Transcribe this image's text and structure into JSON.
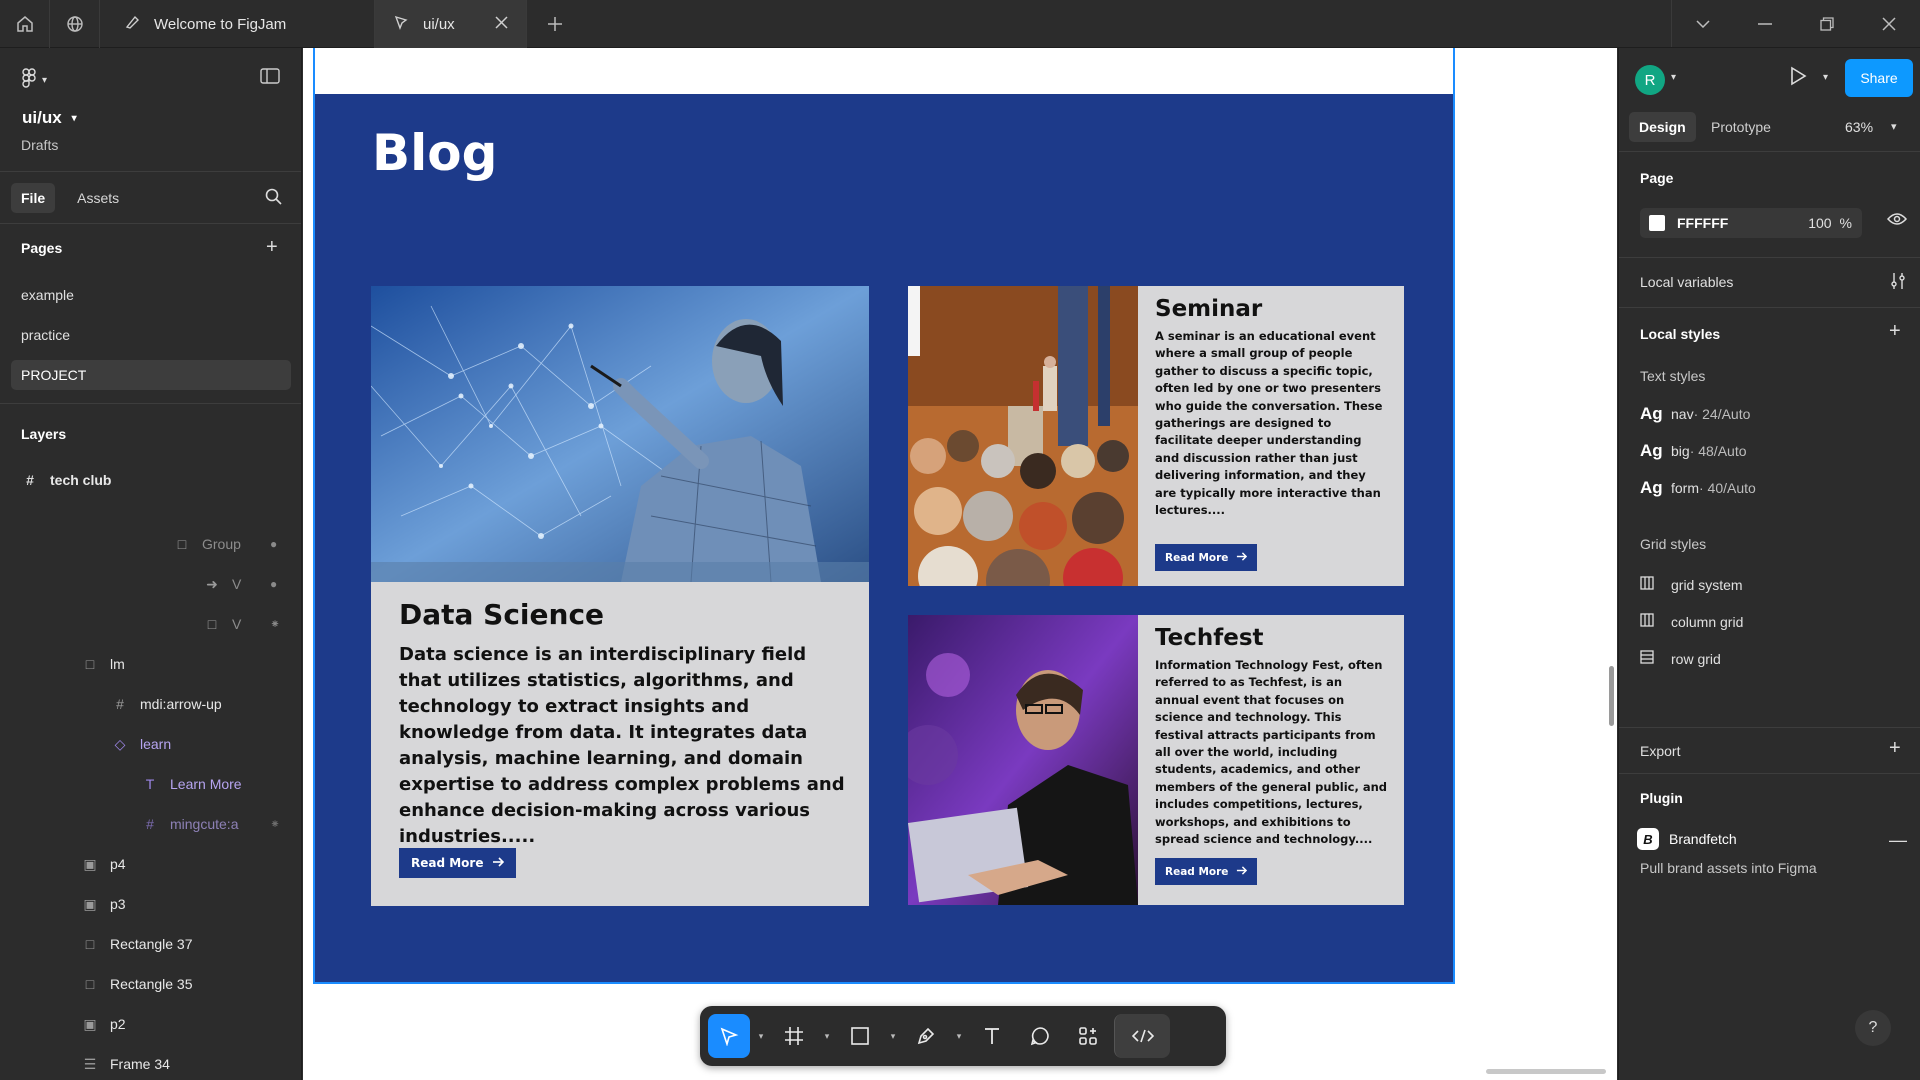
{
  "tabs": [
    {
      "label": "Welcome to FigJam"
    },
    {
      "label": "ui/ux"
    }
  ],
  "left": {
    "file_name": "ui/ux",
    "location": "Drafts",
    "tab_file": "File",
    "tab_assets": "Assets",
    "pages_title": "Pages",
    "pages": [
      "example",
      "practice",
      "PROJECT"
    ],
    "layers_title": "Layers",
    "layers": [
      {
        "name": "tech club",
        "icon": "frame-icon"
      },
      {
        "name": "Group",
        "icon": "group-icon"
      },
      {
        "name": "V",
        "icon": "arrow-icon"
      },
      {
        "name": "V",
        "icon": "rectangle-icon"
      },
      {
        "name": "lm",
        "icon": "group-icon"
      },
      {
        "name": "mdi:arrow-up",
        "icon": "frame-icon"
      },
      {
        "name": "learn",
        "icon": "component-icon"
      },
      {
        "name": "Learn More",
        "icon": "text-icon"
      },
      {
        "name": "mingcute:a",
        "icon": "frame-icon"
      },
      {
        "name": "p4",
        "icon": "image-icon"
      },
      {
        "name": "p3",
        "icon": "image-icon"
      },
      {
        "name": "Rectangle 37",
        "icon": "rectangle-icon"
      },
      {
        "name": "Rectangle 35",
        "icon": "rectangle-icon"
      },
      {
        "name": "p2",
        "icon": "image-icon"
      },
      {
        "name": "Frame 34",
        "icon": "auto-layout-icon"
      }
    ]
  },
  "canvas": {
    "blog_title": "Blog",
    "cards": [
      {
        "title": "Data Science",
        "body": "Data science is an interdisciplinary field that utilizes statistics, algorithms, and technology to extract insights and knowledge from data. It integrates data analysis, machine learning, and domain expertise to address complex problems and enhance decision-making across various industries.....",
        "button": "Read More"
      },
      {
        "title": "Seminar",
        "body": "A seminar is an educational event where a small group of people gather to discuss a specific topic, often led by one or two presenters who guide the conversation. These gatherings are designed to facilitate deeper understanding and discussion rather than just delivering information, and they are typically more interactive than lectures....",
        "button": "Read More"
      },
      {
        "title": "Techfest",
        "body": "Information Technology Fest, often referred to as Techfest, is an annual event that focuses on science and technology. This festival attracts participants from all over the world, including students, academics, and other members of the general public, and includes competitions, lectures, workshops, and exhibitions to spread science and technology....",
        "button": "Read More"
      }
    ]
  },
  "right": {
    "avatar_initial": "R",
    "share": "Share",
    "tab_design": "Design",
    "tab_prototype": "Prototype",
    "zoom": "63%",
    "page_title": "Page",
    "page_color": "FFFFFF",
    "page_opacity": "100",
    "page_opacity_unit": "%",
    "local_variables": "Local variables",
    "local_styles": "Local styles",
    "text_styles_title": "Text styles",
    "text_styles": [
      {
        "ag": "Ag",
        "name": "nav",
        "meta": " · 24/Auto"
      },
      {
        "ag": "Ag",
        "name": "big",
        "meta": " · 48/Auto"
      },
      {
        "ag": "Ag",
        "name": "form",
        "meta": " · 40/Auto"
      }
    ],
    "grid_styles_title": "Grid styles",
    "grid_styles": [
      "grid system",
      "column grid",
      "row grid"
    ],
    "export": "Export",
    "plugin_title": "Plugin",
    "plugin_name": "Brandfetch",
    "plugin_logo": "B",
    "plugin_desc": "Pull brand assets into Figma",
    "help": "?"
  }
}
